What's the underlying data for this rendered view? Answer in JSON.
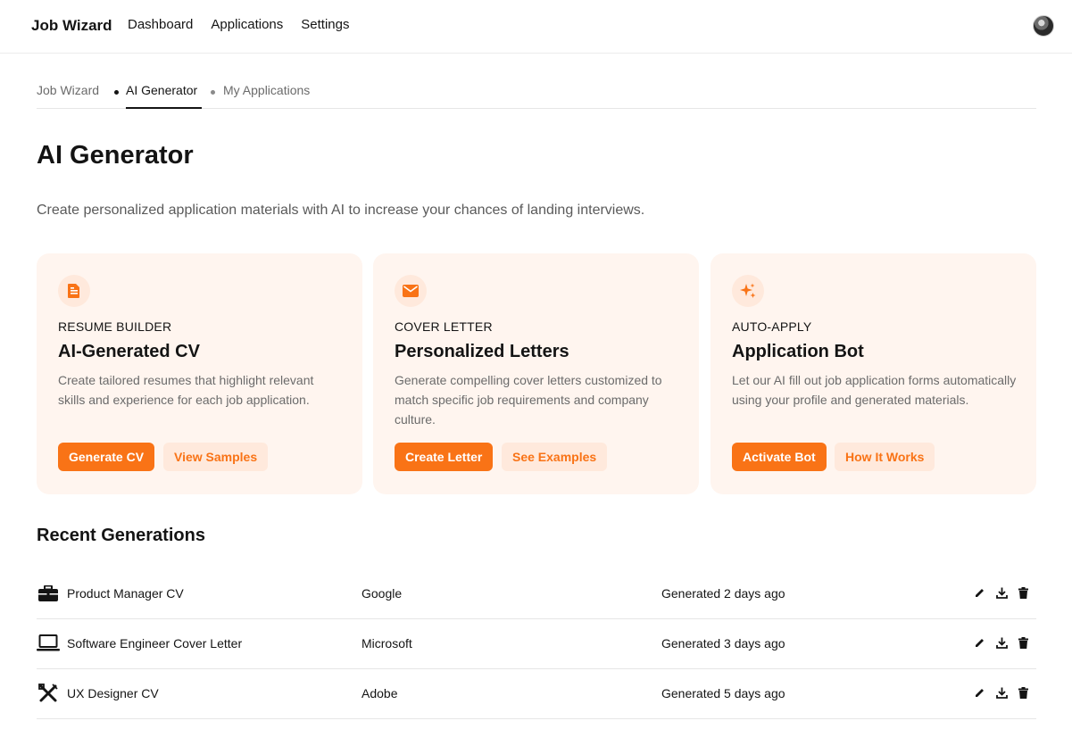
{
  "app": {
    "title": "Job Wizard"
  },
  "nav": {
    "items": [
      "Dashboard",
      "Applications",
      "Settings"
    ]
  },
  "user": {
    "avatar_icon": "user-avatar"
  },
  "breadcrumb": {
    "items": [
      {
        "label": "Job Wizard",
        "active": false
      },
      {
        "label": "AI Generator",
        "active": true
      },
      {
        "label": "My Applications",
        "active": false
      }
    ]
  },
  "page": {
    "title": "AI Generator",
    "subtitle": "Create personalized application materials with AI to increase your chances of landing interviews."
  },
  "cards": [
    {
      "icon": "document-icon",
      "eyebrow": "RESUME BUILDER",
      "title": "AI-Generated CV",
      "description": "Create tailored resumes that highlight relevant skills and experience for each job application.",
      "primary": "Generate CV",
      "secondary": "View Samples"
    },
    {
      "icon": "mail-icon",
      "eyebrow": "COVER LETTER",
      "title": "Personalized Letters",
      "description": "Generate compelling cover letters customized to match specific job requirements and company culture.",
      "primary": "Create Letter",
      "secondary": "See Examples"
    },
    {
      "icon": "sparkle-icon",
      "eyebrow": "AUTO-APPLY",
      "title": "Application Bot",
      "description": "Let our AI fill out job application forms automatically using your profile and generated materials.",
      "primary": "Activate Bot",
      "secondary": "How It Works"
    }
  ],
  "recent": {
    "title": "Recent Generations",
    "rows": [
      {
        "icon": "briefcase-icon",
        "name": "Product Manager CV",
        "company": "Google",
        "date": "Generated 2 days ago"
      },
      {
        "icon": "laptop-icon",
        "name": "Software Engineer Cover Letter",
        "company": "Microsoft",
        "date": "Generated 3 days ago"
      },
      {
        "icon": "design-tools-icon",
        "name": "UX Designer CV",
        "company": "Adobe",
        "date": "Generated 5 days ago"
      }
    ],
    "actions": [
      "edit-icon",
      "download-icon",
      "delete-icon"
    ]
  },
  "colors": {
    "accent": "#f97316",
    "card_bg": "#fff5ef",
    "icon_bg": "#ffe9dc"
  }
}
